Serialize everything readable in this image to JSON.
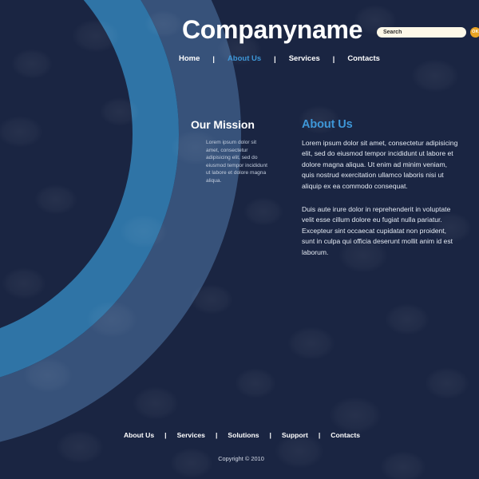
{
  "site": {
    "logo_text": "Companyname",
    "background_color": "#1a2542",
    "accent_color": "#3e97d8",
    "ring_outer_color": "#37527a",
    "ring_inner_color": "#2f74a6",
    "button_color": "#e9a424"
  },
  "search": {
    "placeholder": "Search",
    "value": "",
    "submit_label": "OK"
  },
  "nav": {
    "items": [
      {
        "label": "Home",
        "active": false
      },
      {
        "label": "About Us",
        "active": true
      },
      {
        "label": "Services",
        "active": false
      },
      {
        "label": "Contacts",
        "active": false
      }
    ],
    "separator": "|"
  },
  "mission": {
    "title": "Our Mission",
    "body": "Lorem ipsum dolor sit amet, consectetur adipisicing elit, sed do eiusmod tempor incididunt ut labore et dolore magna aliqua."
  },
  "about": {
    "title": "About Us",
    "paragraph1": "Lorem ipsum dolor sit amet, consectetur adipisicing elit, sed do eiusmod tempor incididunt ut labore et dolore magna aliqua. Ut enim ad minim veniam, quis nostrud exercitation ullamco laboris nisi ut aliquip ex ea commodo consequat.",
    "paragraph2": "Duis aute irure dolor in reprehenderit in voluptate velit esse cillum dolore eu fugiat nulla pariatur. Excepteur sint occaecat cupidatat non proident, sunt in culpa qui officia deserunt mollit anim id est laborum."
  },
  "footer": {
    "links": [
      {
        "label": "About Us"
      },
      {
        "label": "Services"
      },
      {
        "label": "Solutions"
      },
      {
        "label": "Support"
      },
      {
        "label": "Contacts"
      }
    ],
    "separator": "|",
    "copyright": "Copyright © 2010"
  }
}
